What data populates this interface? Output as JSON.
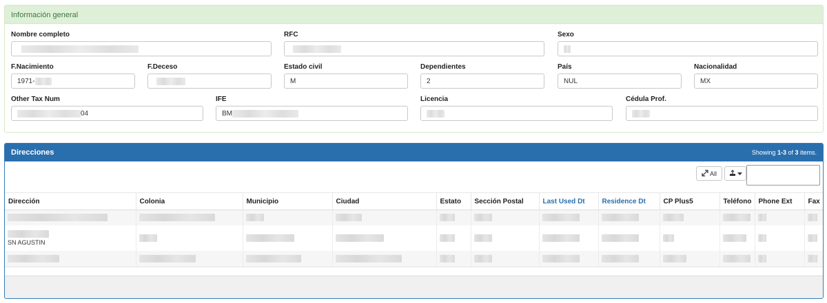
{
  "info": {
    "title": "Información general",
    "fields": {
      "nombre_completo": {
        "label": "Nombre completo",
        "value": ""
      },
      "rfc": {
        "label": "RFC",
        "value": ""
      },
      "sexo": {
        "label": "Sexo",
        "value": ""
      },
      "f_nacimiento": {
        "label": "F.Nacimiento",
        "value": "1971-"
      },
      "f_deceso": {
        "label": "F.Deceso",
        "value": ""
      },
      "estado_civil": {
        "label": "Estado civil",
        "value": "M"
      },
      "dependientes": {
        "label": "Dependientes",
        "value": "2"
      },
      "pais": {
        "label": "País",
        "value": "NUL"
      },
      "nacionalidad": {
        "label": "Nacionalidad",
        "value": "MX"
      },
      "other_tax_num": {
        "label": "Other Tax Num",
        "value": "04"
      },
      "ife": {
        "label": "IFE",
        "value": "BM"
      },
      "licencia": {
        "label": "Licencia",
        "value": ""
      },
      "cedula_prof": {
        "label": "Cédula Prof.",
        "value": ""
      }
    }
  },
  "direcciones": {
    "title": "Direcciones",
    "summary": {
      "prefix": "Showing ",
      "range": "1-3",
      "of": " of ",
      "total": "3",
      "suffix": " items."
    },
    "toolbar": {
      "expand_all_label": "All",
      "expand_icon": "expand-arrows-icon",
      "export_icon": "export-icon",
      "caret_icon": "caret-down-icon"
    },
    "columns": [
      "Dirección",
      "Colonia",
      "Municipio",
      "Ciudad",
      "Estato",
      "Sección Postal",
      "Last Used Dt",
      "Residence Dt",
      "CP Plus5",
      "Teléfono",
      "Phone Ext",
      "Fax"
    ],
    "sortable_columns": [
      "Last Used Dt",
      "Residence Dt"
    ],
    "rows": [
      {
        "direccion_extra": ""
      },
      {
        "direccion_extra": "SN AGUSTIN"
      },
      {
        "direccion_extra": ""
      }
    ]
  },
  "colors": {
    "success_bg": "#dff0d8",
    "success_text": "#3c763d",
    "primary": "#2a6fad"
  }
}
